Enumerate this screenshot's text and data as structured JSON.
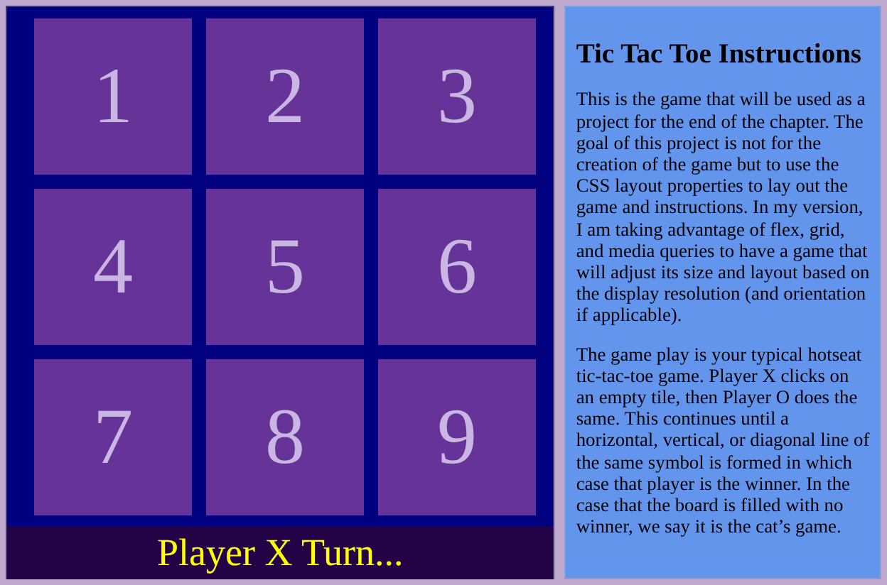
{
  "board": {
    "tiles": [
      "1",
      "2",
      "3",
      "4",
      "5",
      "6",
      "7",
      "8",
      "9"
    ],
    "status": "Player X Turn..."
  },
  "instructions": {
    "title": "Tic Tac Toe Instructions",
    "paragraphs": [
      "This is the game that will be used as a project for the end of the chapter. The goal of this project is not for the creation of the game but to use the CSS layout properties to lay out the game and instructions. In my version, I am taking advantage of flex, grid, and media queries to have a game that will adjust its size and layout based on the display resolution (and orientation if applicable).",
      "The game play is your typical hotseat tic-tac-toe game. Player X clicks on an empty tile, then Player O does the same. This continues until a horizontal, vertical, or diagonal line of the same symbol is formed in which case that player is the winner. In the case that the board is filled with no winner, we say it is the cat’s game."
    ]
  }
}
